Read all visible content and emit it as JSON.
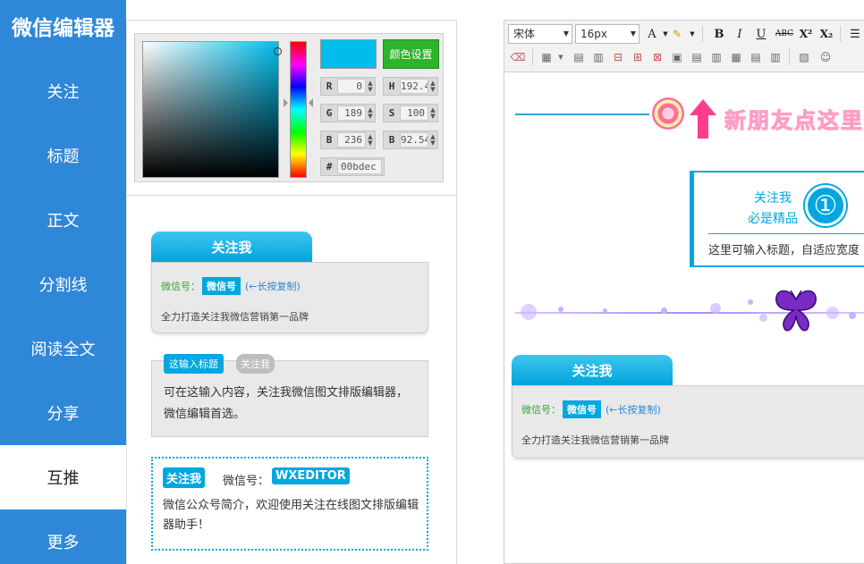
{
  "sidebar": {
    "brand": "微信编辑器",
    "items": [
      {
        "label": "关注"
      },
      {
        "label": "标题"
      },
      {
        "label": "正文"
      },
      {
        "label": "分割线"
      },
      {
        "label": "阅读全文"
      },
      {
        "label": "分享"
      },
      {
        "label": "互推"
      },
      {
        "label": "更多"
      }
    ],
    "active_index": 6
  },
  "color_picker": {
    "set_button": "颜色设置",
    "current_color": "#00bdec",
    "fields": {
      "r": {
        "label": "R",
        "value": "0"
      },
      "g": {
        "label": "G",
        "value": "189"
      },
      "b": {
        "label": "B",
        "value": "236"
      },
      "h": {
        "label": "H",
        "value": "192.457"
      },
      "s": {
        "label": "S",
        "value": "100"
      },
      "br": {
        "label": "B",
        "value": "92.5490"
      },
      "hex": {
        "label": "#",
        "value": "00bdec"
      }
    }
  },
  "templates": {
    "card1": {
      "title": "关注我",
      "wx_label": "微信号：",
      "wx_badge": "微信号",
      "hint": "(←长按复制)",
      "slogan": "全力打造关注我微信营销第一品牌"
    },
    "card2": {
      "title_pill": "这输入标题",
      "follow_pill": "关注我",
      "text": "可在这输入内容，关注我微信图文排版编辑器，微信编辑首选。"
    },
    "card3": {
      "tag": "关注我",
      "id_label": "微信号：",
      "id_value": "WXEDITOR",
      "text": "微信公众号简介，欢迎使用关注在线图文排版编辑器助手！"
    }
  },
  "editor": {
    "toolbar": {
      "font_family": "宋体",
      "font_size": "16px",
      "buttons": {
        "font_color": "A",
        "bold": "B",
        "italic": "I",
        "underline": "U",
        "strike": "ABC",
        "superscript": "X²",
        "subscript": "X₂"
      }
    },
    "content": {
      "heading_text": "新朋友点这里",
      "follow_text_1": "关注我",
      "follow_text_2": "必是精品",
      "number": "①",
      "subtitle": "这里可输入标题，自适应宽度",
      "card_title": "关注我",
      "wx_label": "微信号：",
      "wx_badge": "微信号",
      "hint": "(←长按复制)",
      "slogan": "全力打造关注我微信营销第一品牌"
    }
  }
}
